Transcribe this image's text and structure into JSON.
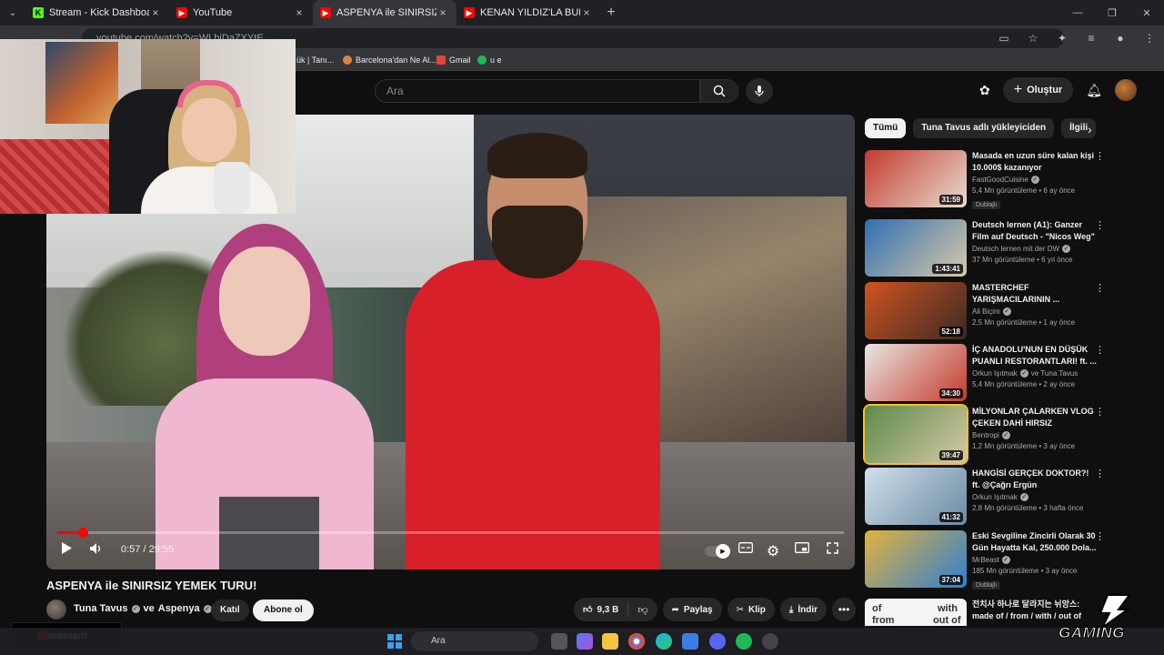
{
  "browser": {
    "tabs": [
      {
        "label": "Stream - Kick Dashboard",
        "icon": "kick-icon",
        "color": "#53fc18"
      },
      {
        "label": "YouTube",
        "icon": "youtube-icon",
        "color": "#ff0000"
      },
      {
        "label": "ASPENYA ile SINIRSIZ YEMEK TU",
        "icon": "youtube-icon",
        "color": "#ff0000",
        "active": true
      },
      {
        "label": "KENAN YILDIZ'LA BULUŞTUM -",
        "icon": "youtube-icon",
        "color": "#ff0000"
      }
    ],
    "url": "youtube.com/watch?v=WLbiDaZXYtE",
    "bookmarks": [
      {
        "label": "ük | Tanı..."
      },
      {
        "label": "Barcelona'dan Ne Al..."
      },
      {
        "label": "Gmail"
      },
      {
        "label": "u e"
      }
    ]
  },
  "youtube": {
    "search_placeholder": "Ara",
    "create_label": "Oluştur"
  },
  "player": {
    "time": "0:57 / 29:55",
    "progress": 0.032,
    "mode_label": "1"
  },
  "video": {
    "title": "ASPENYA ile SINIRSIZ YEMEK TURU!",
    "channel_1": "Tuna Tavus",
    "channel_joiner": "ve",
    "channel_2": "Aspenya",
    "join_label": "Katıl",
    "subscribe_label": "Abone ol",
    "likes": "9,3 B",
    "share_label": "Paylaş",
    "clip_label": "Klip",
    "download_label": "İndir"
  },
  "chips": [
    "Tümü",
    "Tuna Tavus adlı yükleyiciden",
    "İlgili"
  ],
  "recommendations": [
    {
      "title": "Masada en uzun süre kalan kişi 10.000$ kazanıyor",
      "channel": "FastGoodCuisine",
      "verified": true,
      "meta": "5,4 Mn görüntüleme • 6 ay önce",
      "badge": "Dublajlı",
      "duration": "31:59",
      "thumb": [
        "#c23a2e",
        "#e9dcd0"
      ]
    },
    {
      "title": "Deutsch lernen (A1): Ganzer Film auf Deutsch - \"Nicos Weg\"",
      "channel": "Deutsch lernen mit der DW",
      "verified": true,
      "meta": "37 Mn görüntüleme • 6 yıl önce",
      "badge": "",
      "duration": "1:43:41",
      "thumb": [
        "#2f6fb3",
        "#d9c9a8"
      ]
    },
    {
      "title": "MASTERCHEF YARIŞMACILARININ ...",
      "channel": "Ali Biçim",
      "verified": true,
      "meta": "2,5 Mn görüntüleme • 1 ay önce",
      "badge": "",
      "duration": "52:18",
      "thumb": [
        "#d0541f",
        "#3b2a24"
      ]
    },
    {
      "title": "İÇ ANADOLU'NUN EN DÜŞÜK PUANLI RESTORANTLARI! ft. ...",
      "channel": "Orkun Işıtmak",
      "verified": true,
      "channel_extra": "ve Tuna Tavus",
      "meta": "5,4 Mn görüntüleme • 2 ay önce",
      "badge": "",
      "duration": "34:30",
      "thumb": [
        "#e8e6e2",
        "#c53a2c"
      ]
    },
    {
      "title": "MİLYONLAR ÇALARKEN VLOG ÇEKEN DAHİ HIRSIZ",
      "channel": "Bentropi",
      "verified": true,
      "meta": "1,2 Mn görüntüleme • 3 ay önce",
      "badge": "",
      "duration": "39:47",
      "thumb": [
        "#5d8a4a",
        "#d7c9a6"
      ]
    },
    {
      "title": "HANGİSİ GERÇEK DOKTOR?! ft. @Çağrı Ergün",
      "channel": "Orkun Işıtmak",
      "verified": true,
      "meta": "2,8 Mn görüntüleme • 3 hafta önce",
      "badge": "",
      "duration": "41:32",
      "thumb": [
        "#cfe0ea",
        "#6b8aa3"
      ]
    },
    {
      "title": "Eski Sevgiline Zincirli Olarak 30 Gün Hayatta Kal, 250.000 Dola...",
      "channel": "MrBeast",
      "verified": true,
      "meta": "185 Mn görüntüleme • 3 ay önce",
      "badge": "Dublajlı",
      "duration": "37:04",
      "thumb": [
        "#e3b23c",
        "#2f7fd1"
      ]
    }
  ],
  "next_item": {
    "title": "전치사 하나로 달라지는 뉘앙스: made of / from / with / out of",
    "thumb_words": [
      "of",
      "with",
      "from",
      "out of"
    ]
  },
  "stream_overlay": {
    "username": "handesarri"
  },
  "taskbar": {
    "search_label": "Ara"
  },
  "watermark": {
    "text": "GAMING"
  }
}
